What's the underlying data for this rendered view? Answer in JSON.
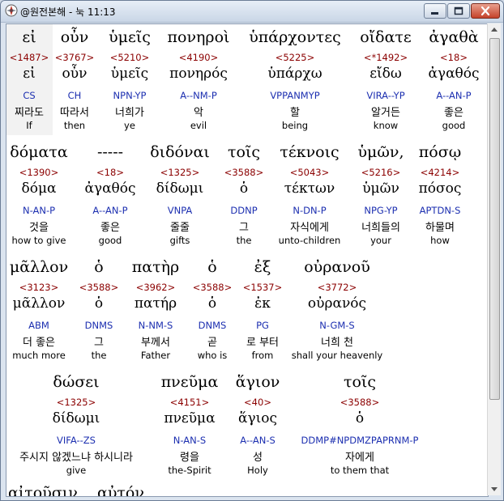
{
  "window": {
    "title": "@원전본해 - 눅 11:13",
    "icon": "compass-app-icon"
  },
  "controls": {
    "minimize": "minimize-icon",
    "maximize": "maximize-icon",
    "close": "close-icon"
  },
  "rows": [
    {
      "words": [
        {
          "greek": "εἰ",
          "strong": "<1487>",
          "lemma": "εἰ",
          "parse": "CS",
          "korean": "찌라도",
          "english": "If"
        },
        {
          "greek": "οὖν",
          "strong": "<3767>",
          "lemma": "οὖν",
          "parse": "CH",
          "korean": "따라서",
          "english": "then"
        },
        {
          "greek": "ὑμεῖς",
          "strong": "<5210>",
          "lemma": "ὑμεῖς",
          "parse": "NPN-YP",
          "korean": "너희가",
          "english": "ye"
        },
        {
          "greek": "πονηροὶ",
          "strong": "<4190>",
          "lemma": "πονηρός",
          "parse": "A--NM-P",
          "korean": "악",
          "english": "evil"
        },
        {
          "greek": "ὑπάρχοντες",
          "strong": "<5225>",
          "lemma": "ὑπάρχω",
          "parse": "VPPANMYP",
          "korean": "할",
          "english": "being"
        },
        {
          "greek": "οἴδατε",
          "strong": "<*1492>",
          "lemma": "εἴδω",
          "parse": "VIRA--YP",
          "korean": "알거든",
          "english": "know"
        },
        {
          "greek": "ἀγαθὰ",
          "strong": "<18>",
          "lemma": "ἀγαθός",
          "parse": "A--AN-P",
          "korean": "좋은",
          "english": "good"
        }
      ]
    },
    {
      "words": [
        {
          "greek": "δόματα",
          "strong": "<1390>",
          "lemma": "δόμα",
          "parse": "N-AN-P",
          "korean": "것을",
          "english": "how to give"
        },
        {
          "greek": "-----",
          "strong": "<18>",
          "lemma": "ἀγαθός",
          "parse": "A--AN-P",
          "korean": "좋은",
          "english": "good"
        },
        {
          "greek": "διδόναι",
          "strong": "<1325>",
          "lemma": "δίδωμι",
          "parse": "VNPA",
          "korean": "줄줄",
          "english": "gifts"
        },
        {
          "greek": "τοῖς",
          "strong": "<3588>",
          "lemma": "ὁ",
          "parse": "DDNP",
          "korean": "그",
          "english": "the"
        },
        {
          "greek": "τέκνοις",
          "strong": "<5043>",
          "lemma": "τέκτων",
          "parse": "N-DN-P",
          "korean": "자식에게",
          "english": "unto-children"
        },
        {
          "greek": "ὑμῶν,",
          "strong": "<5216>",
          "lemma": "ὑμῶν",
          "parse": "NPG-YP",
          "korean": "너희들의",
          "english": "your"
        },
        {
          "greek": "πόσῳ",
          "strong": "<4214>",
          "lemma": "πόσος",
          "parse": "APTDN-S",
          "korean": "하물며",
          "english": "how"
        }
      ]
    },
    {
      "words": [
        {
          "greek": "μᾶλλον",
          "strong": "<3123>",
          "lemma": "μᾶλλον",
          "parse": "ABM",
          "korean": "더 좋은",
          "english": "much more"
        },
        {
          "greek": "ὁ",
          "strong": "<3588>",
          "lemma": "ὁ",
          "parse": "DNMS",
          "korean": "그",
          "english": "the"
        },
        {
          "greek": "πατὴρ",
          "strong": "<3962>",
          "lemma": "πατήρ",
          "parse": "N-NM-S",
          "korean": "부께서",
          "english": "Father"
        },
        {
          "greek": "ὁ",
          "strong": "<3588>",
          "lemma": "ὁ",
          "parse": "DNMS",
          "korean": "곧",
          "english": "who is"
        },
        {
          "greek": "ἐξ",
          "strong": "<1537>",
          "lemma": "ἐκ",
          "parse": "PG",
          "korean": "로 부터",
          "english": "from"
        },
        {
          "greek": "οὐρανοῦ",
          "strong": "<3772>",
          "lemma": "οὐρανός",
          "parse": "N-GM-S",
          "korean": "너희 천",
          "english": "shall your heavenly"
        }
      ]
    },
    {
      "words": [
        {
          "greek": "δώσει",
          "strong": "<1325>",
          "lemma": "δίδωμι",
          "parse": "VIFA--ZS",
          "korean": "주시지 않겠느냐 하시니라",
          "english": "give"
        },
        {
          "greek": "πνεῦμα",
          "strong": "<4151>",
          "lemma": "πνεῦμα",
          "parse": "N-AN-S",
          "korean": "령을",
          "english": "the-Spirit"
        },
        {
          "greek": "ἅγιον",
          "strong": "<40>",
          "lemma": "ἅγιος",
          "parse": "A--AN-S",
          "korean": "성",
          "english": "Holy"
        },
        {
          "greek": "τοῖς",
          "strong": "<3588>",
          "lemma": "ὁ",
          "parse": "DDMP#NPDMZPAPRNM-P",
          "korean": "자에게",
          "english": "to them that"
        }
      ]
    }
  ],
  "partial_line": {
    "words": [
      "αἰτοῦσιν",
      "αὐτόν"
    ]
  }
}
